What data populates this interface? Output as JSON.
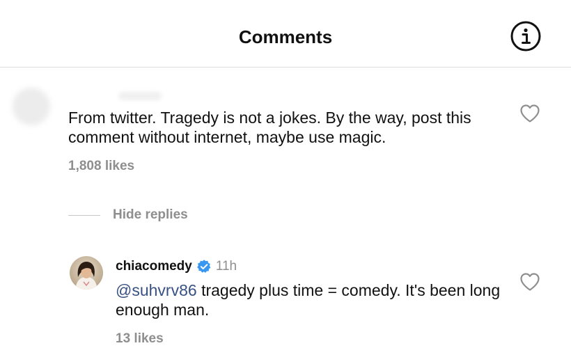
{
  "header": {
    "title": "Comments",
    "info_icon": "info-circle-icon"
  },
  "comments": [
    {
      "username": "",
      "text": "From twitter. Tragedy is not a jokes. By the way, post this comment without internet, maybe use magic.",
      "likes": "1,808 likes",
      "like_icon": "heart-outline-icon",
      "replies_toggle": "Hide replies",
      "replies": [
        {
          "username": "chiacomedy",
          "verified_icon": "verified-badge-icon",
          "time": "11h",
          "mention": "@suhvrv86",
          "text": " tragedy plus time = comedy. It's been long enough man.",
          "likes": "13 likes",
          "like_icon": "heart-outline-icon"
        }
      ]
    }
  ],
  "colors": {
    "text": "#111111",
    "muted": "#8e8e8e",
    "mention": "#385185",
    "verified": "#3897f0",
    "divider": "#dbdbdb"
  }
}
